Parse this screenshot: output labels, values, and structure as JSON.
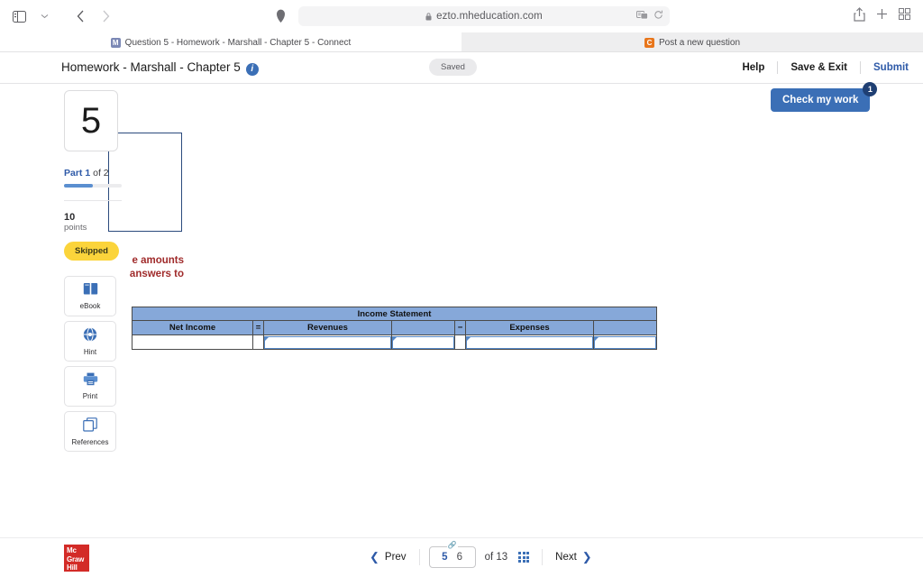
{
  "browser": {
    "url": "ezto.mheducation.com",
    "icons": {
      "sidebar": "sidebar-toggle-icon",
      "dropdown": "chevron-down-icon",
      "back": "back-arrow-icon",
      "forward": "forward-arrow-icon",
      "shield": "privacy-shield-icon",
      "lock": "lock-icon",
      "reader": "reader-view-icon",
      "reload": "reload-icon",
      "share": "share-icon",
      "newtab": "plus-icon",
      "tabs": "tab-overview-icon"
    },
    "tabs": [
      {
        "title": "Question 5 - Homework - Marshall - Chapter 5 - Connect",
        "favicon": "M",
        "active": true
      },
      {
        "title": "Post a new question",
        "favicon": "C",
        "active": false
      }
    ]
  },
  "header": {
    "title": "Homework - Marshall - Chapter 5",
    "info_icon": "info-icon",
    "saved_label": "Saved",
    "help_label": "Help",
    "save_exit_label": "Save & Exit",
    "submit_label": "Submit"
  },
  "check_work": {
    "label": "Check my work",
    "badge": "1"
  },
  "question_panel": {
    "number": "5",
    "part_prefix": "Part 1",
    "part_suffix": " of 2",
    "progress_percent": 50,
    "points_value": "10",
    "points_label": "points",
    "status_badge": "Skipped"
  },
  "tools": [
    {
      "label": "eBook",
      "icon": "ebook-icon"
    },
    {
      "label": "Hint",
      "icon": "hint-icon"
    },
    {
      "label": "Print",
      "icon": "print-icon"
    },
    {
      "label": "References",
      "icon": "references-icon"
    }
  ],
  "content": {
    "instruction_line_1": "e amounts",
    "instruction_line_2": "answers to"
  },
  "income_statement": {
    "title": "Income Statement",
    "headers": [
      "Net Income",
      "=",
      "Revenues",
      "",
      "−",
      "Expenses",
      ""
    ],
    "row": [
      "",
      "",
      "",
      "",
      "",
      "",
      ""
    ]
  },
  "footer": {
    "logo_line_1": "Mc",
    "logo_line_2": "Graw",
    "logo_line_3": "Hill",
    "prev_label": "Prev",
    "next_label": "Next",
    "current_page": "5",
    "next_page": "6",
    "of_label": "of 13",
    "grid_icon": "grid-view-icon",
    "chain_icon": "linked-pages-icon"
  },
  "colors": {
    "accent_blue": "#3b6fb6",
    "link_blue": "#2e5aa8",
    "table_header": "#86a8d9",
    "skipped_yellow": "#fbd43b",
    "instruction_red": "#a02b2b",
    "logo_red": "#d32b27"
  }
}
